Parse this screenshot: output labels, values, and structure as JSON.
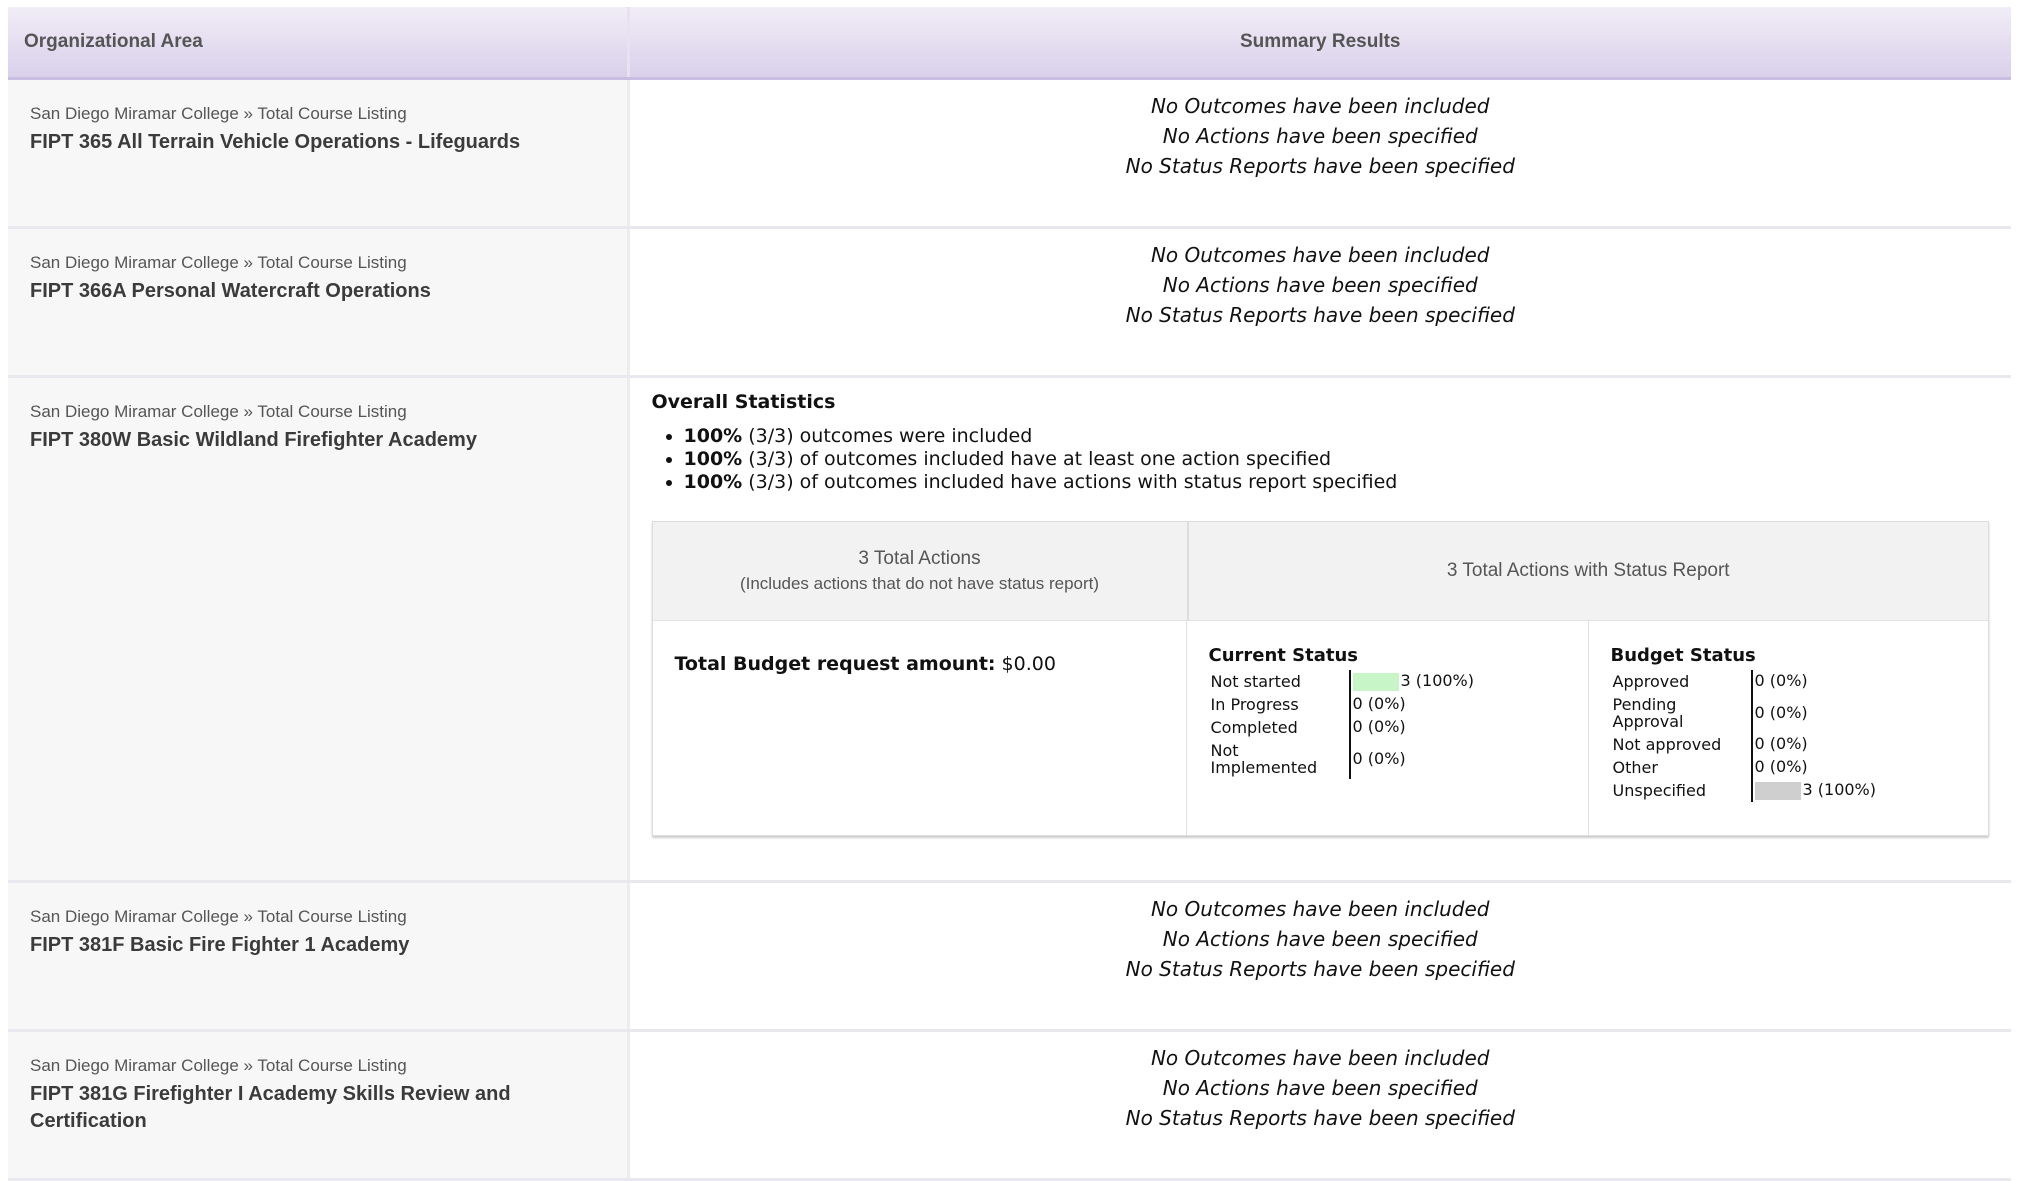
{
  "header": {
    "col1": "Organizational Area",
    "col2": "Summary Results"
  },
  "rows": [
    {
      "crumb": "San Diego Miramar College » Total Course Listing",
      "course": "FIPT 365 All Terrain Vehicle Operations - Lifeguards",
      "empty": [
        "No Outcomes have been included",
        "No Actions have been specified",
        "No Status Reports have been specified"
      ]
    },
    {
      "crumb": "San Diego Miramar College » Total Course Listing",
      "course": "FIPT 366A Personal Watercraft Operations",
      "empty": [
        "No Outcomes have been included",
        "No Actions have been specified",
        "No Status Reports have been specified"
      ]
    },
    {
      "crumb": "San Diego Miramar College » Total Course Listing",
      "course": "FIPT 380W Basic Wildland Firefighter Academy",
      "stats": {
        "title": "Overall Statistics",
        "bullets": [
          {
            "pct": "100%",
            "text": " (3/3) outcomes were included"
          },
          {
            "pct": "100%",
            "text": " (3/3) of outcomes included have at least one action specified"
          },
          {
            "pct": "100%",
            "text": " (3/3) of outcomes included have actions with status report specified"
          }
        ],
        "total_actions": "3 Total Actions",
        "total_actions_note": "(Includes actions that do not have status report)",
        "total_with_status": "3 Total Actions with Status Report",
        "budget_label": "Total Budget request amount:",
        "budget_value": " $0.00",
        "current_status": {
          "title": "Current Status",
          "items": [
            {
              "label": "Not started",
              "value": "3 (100%)",
              "fraction": 1.0
            },
            {
              "label": "In Progress",
              "value": "0 (0%)",
              "fraction": 0
            },
            {
              "label": "Completed",
              "value": "0 (0%)",
              "fraction": 0
            },
            {
              "label": "Not Implemented",
              "value": "0 (0%)",
              "fraction": 0
            }
          ],
          "bar_color": "#c7f5c7"
        },
        "budget_status": {
          "title": "Budget Status",
          "items": [
            {
              "label": "Approved",
              "value": "0 (0%)",
              "fraction": 0
            },
            {
              "label": "Pending Approval",
              "value": "0 (0%)",
              "fraction": 0
            },
            {
              "label": "Not approved",
              "value": "0 (0%)",
              "fraction": 0
            },
            {
              "label": "Other",
              "value": "0 (0%)",
              "fraction": 0
            },
            {
              "label": "Unspecified",
              "value": "3 (100%)",
              "fraction": 1.0
            }
          ],
          "bar_color": "#cfcfcf"
        }
      }
    },
    {
      "crumb": "San Diego Miramar College » Total Course Listing",
      "course": "FIPT 381F Basic Fire Fighter 1 Academy",
      "empty": [
        "No Outcomes have been included",
        "No Actions have been specified",
        "No Status Reports have been specified"
      ]
    },
    {
      "crumb": "San Diego Miramar College » Total Course Listing",
      "course": "FIPT 381G Firefighter I Academy Skills Review and Certification",
      "empty": [
        "No Outcomes have been included",
        "No Actions have been specified",
        "No Status Reports have been specified"
      ]
    }
  ]
}
